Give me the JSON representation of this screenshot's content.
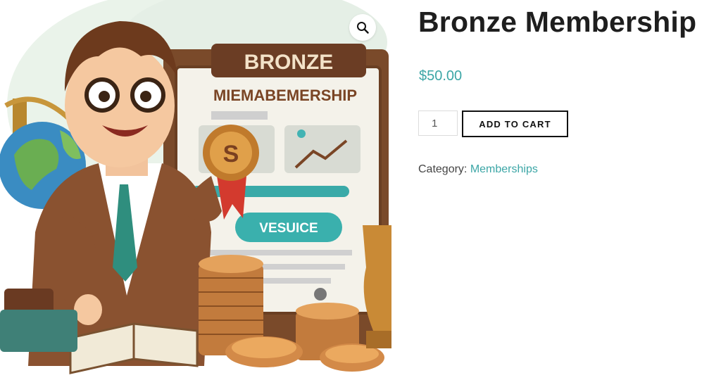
{
  "product": {
    "title": "Bronze Membership",
    "price": "$50.00",
    "quantity": "1",
    "add_to_cart_label": "ADD TO CART",
    "category_label": "Category:",
    "category_value": "Memberships"
  },
  "image": {
    "sign_title": "BRONZE",
    "sign_subtitle": "MIEMABEMERSHIP",
    "button_text": "VESUICE",
    "zoom_icon": "search-icon"
  },
  "colors": {
    "accent": "#3ca6a6",
    "title": "#1e1e1e",
    "button_border": "#111111"
  }
}
